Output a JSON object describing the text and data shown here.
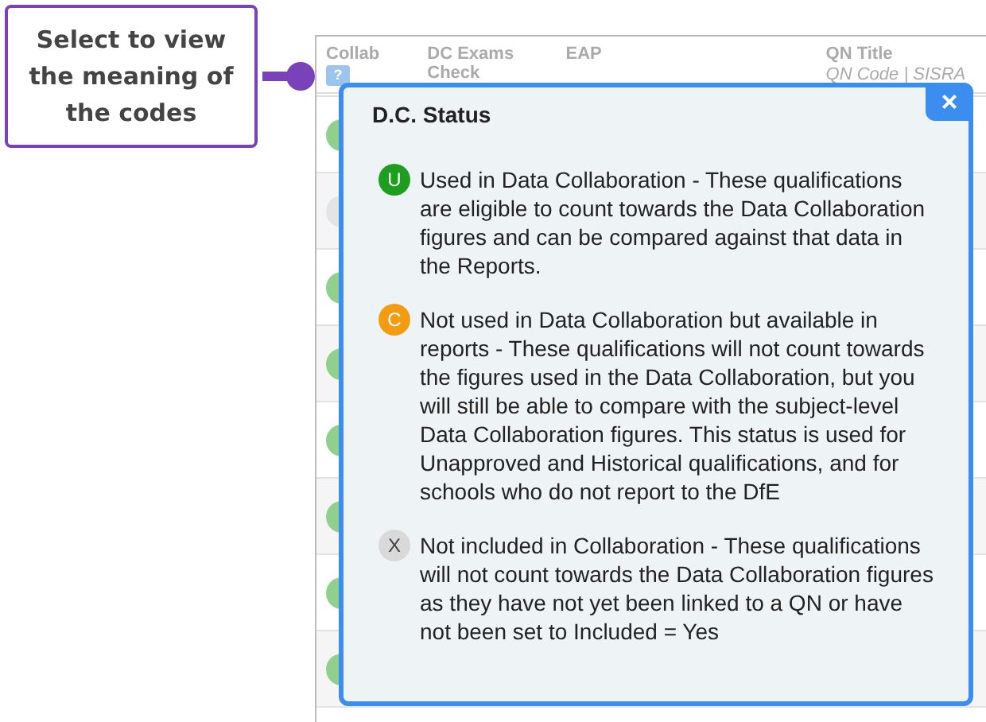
{
  "callout": {
    "text": "Select to view the meaning of the codes"
  },
  "table": {
    "columns": [
      {
        "title": "Collab"
      },
      {
        "title": "DC Exams Check"
      },
      {
        "title": "EAP"
      },
      {
        "title": "QN Title",
        "subtitle": "QN Code | SISRA"
      }
    ],
    "help_button": "?",
    "rows": [
      {
        "color": "#8fd08f"
      },
      {
        "color": "#e4e4e4"
      },
      {
        "color": "#8fd08f"
      },
      {
        "color": "#8fd08f"
      },
      {
        "color": "#8fd08f"
      },
      {
        "color": "#8fd08f"
      },
      {
        "color": "#8fd08f"
      },
      {
        "color": "#8fd08f"
      }
    ]
  },
  "popup": {
    "title": "D.C. Status",
    "close": "×",
    "items": [
      {
        "badge": "U",
        "color": "#1e9e1e",
        "text": "Used in Data Collaboration - These qualifications are eligible to count towards the Data Collaboration figures and can be compared against that data in the Reports."
      },
      {
        "badge": "C",
        "color": "#f39c12",
        "text": "Not used in Data Collaboration but available in reports - These qualifications will not count towards the figures used in the Data Collaboration, but you will still be able to compare with the subject-level Data Collaboration figures. This status is used for Unapproved and Historical qualifications, and for schools who do not report to the DfE"
      },
      {
        "badge": "X",
        "color": "#d9d9d9",
        "text": "Not included in Collaboration - These qualifications will not count towards the Data Collaboration figures as they have not yet been linked to a QN or have not been set to Included = Yes"
      }
    ]
  }
}
